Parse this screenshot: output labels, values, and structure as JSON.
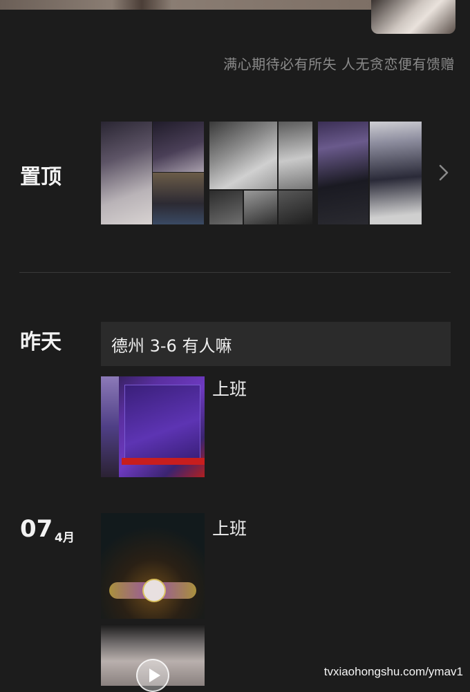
{
  "profile": {
    "signature": "满心期待必有所失 人无贪恋便有馈赠"
  },
  "pinned": {
    "label": "置顶"
  },
  "yesterday": {
    "label": "昨天",
    "text_post": "德州 3-6 有人嘛",
    "photo_post_caption": "上班"
  },
  "july4": {
    "day": "07",
    "month": "4月",
    "post_caption": "上班"
  },
  "watermark": "tvxiaohongshu.com/ymav1",
  "icons": [
    "chevron-right-icon",
    "play-icon"
  ],
  "colors": {
    "background": "#1c1c1c",
    "text_post_bg": "#2b2b2b",
    "divider": "#3a3a3a"
  }
}
